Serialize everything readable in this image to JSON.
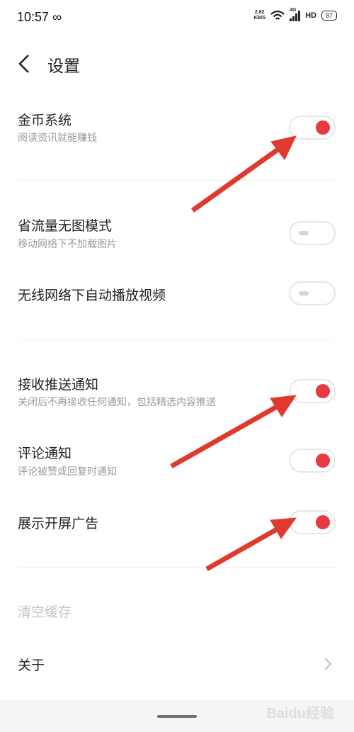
{
  "status_bar": {
    "time": "10:57",
    "infinity_icon": "∞",
    "net_speed_value": "2.82",
    "net_speed_unit": "KB/S",
    "network": "4G",
    "hd": "HD",
    "battery": "87"
  },
  "header": {
    "title": "设置",
    "back_icon": "chevron-left"
  },
  "settings": [
    {
      "label": "金币系统",
      "subtitle": "阅读资讯就能赚钱",
      "on": true
    },
    {
      "label": "省流量无图模式",
      "subtitle": "移动网络下不加载图片",
      "on": false
    },
    {
      "label": "无线网络下自动播放视频",
      "on": false
    },
    {
      "label": "接收推送通知",
      "subtitle": "关闭后不再接收任何通知，包括精选内容推送",
      "on": true
    },
    {
      "label": "评论通知",
      "subtitle": "评论被赞或回复时通知",
      "on": true
    },
    {
      "label": "展示开屏广告",
      "on": true
    }
  ],
  "clear_cache": "清空缓存",
  "about": "关于",
  "colors": {
    "accent": "#e63943",
    "arrow": "#e03a2f"
  },
  "watermark": "Baidu经验"
}
